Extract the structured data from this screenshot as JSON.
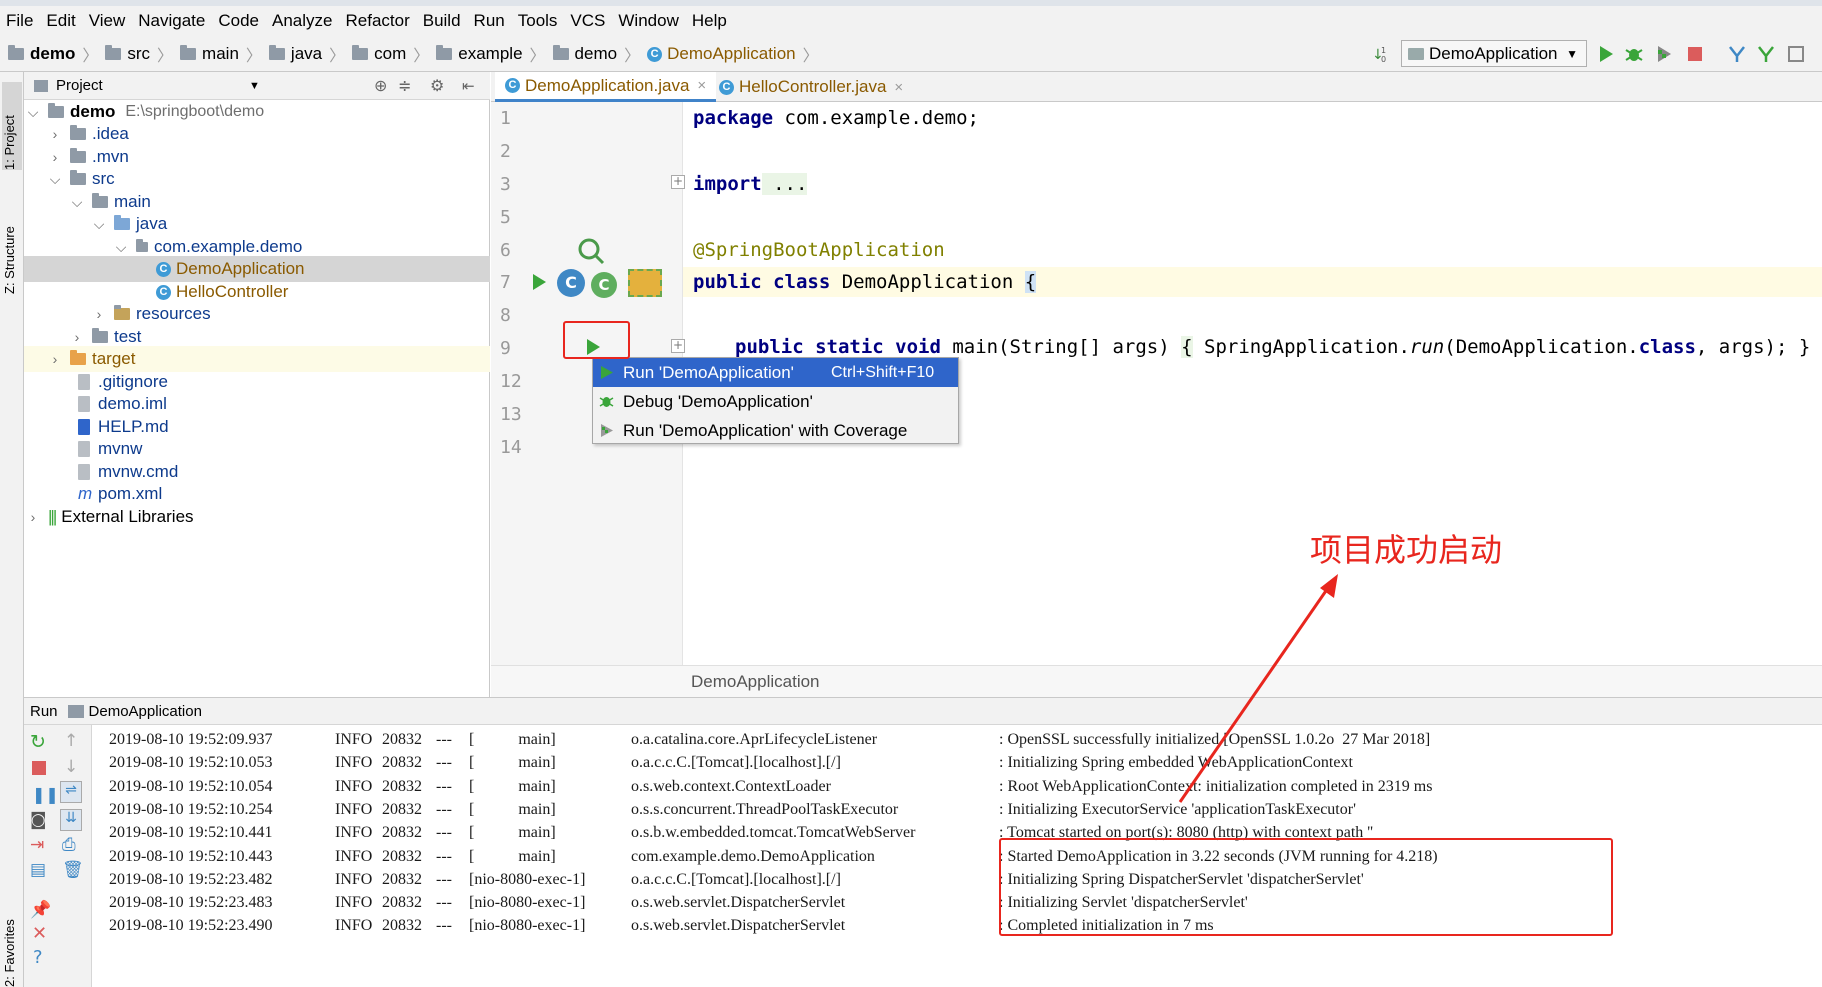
{
  "menu": [
    "File",
    "Edit",
    "View",
    "Navigate",
    "Code",
    "Analyze",
    "Refactor",
    "Build",
    "Run",
    "Tools",
    "VCS",
    "Window",
    "Help"
  ],
  "breadcrumbs": [
    "demo",
    "src",
    "main",
    "java",
    "com",
    "example",
    "demo",
    "DemoApplication"
  ],
  "run_config": "DemoApplication",
  "side_tabs": {
    "project": "1: Project",
    "structure": "Z: Structure",
    "favorites": "2: Favorites"
  },
  "project": {
    "header": "Project",
    "root": {
      "name": "demo",
      "path": "E:\\springboot\\demo"
    },
    "items": [
      ".idea",
      ".mvn",
      "src",
      "main",
      "java",
      "com.example.demo",
      "DemoApplication",
      "HelloController",
      "resources",
      "test",
      "target",
      ".gitignore",
      "demo.iml",
      "HELP.md",
      "mvnw",
      "mvnw.cmd",
      "pom.xml",
      "External Libraries"
    ]
  },
  "tabs": [
    "DemoApplication.java",
    "HelloController.java"
  ],
  "editor": {
    "line_numbers": [
      "1",
      "2",
      "3",
      "5",
      "6",
      "7",
      "8",
      "9",
      "12",
      "13",
      "14"
    ],
    "l1_kw": "package",
    "l1_rest": " com.example.demo;",
    "l3_kw": "import",
    "l3_rest": " ...",
    "annotation": "@SpringBootApplication",
    "l7_kw": "public class",
    "l7_rest": " DemoApplication ",
    "l7_brace": "{",
    "l9_kw": "public static void",
    "l9_rest1": " main(String[] args) ",
    "l9_brace": "{",
    "l9_rest2": " SpringApplication.",
    "l9_run": "run",
    "l9_rest3": "(DemoApplication.",
    "l9_class": "class",
    "l9_rest4": ", args); }",
    "footer": "DemoApplication"
  },
  "popup": {
    "run": "Run 'DemoApplication'",
    "run_shortcut": "Ctrl+Shift+F10",
    "debug": "Debug 'DemoApplication'",
    "coverage": "Run 'DemoApplication' with Coverage"
  },
  "run_panel": {
    "label": "Run",
    "config": "DemoApplication"
  },
  "log": [
    {
      "ts": "2019-08-10 19:52:09.937",
      "lvl": "INFO",
      "pid": "20832",
      "dash": "---",
      "thread": "[           main]",
      "logger": "o.a.catalina.core.AprLifecycleListener",
      "msg": ": OpenSSL successfully initialized [OpenSSL 1.0.2o  27 Mar 2018]"
    },
    {
      "ts": "2019-08-10 19:52:10.053",
      "lvl": "INFO",
      "pid": "20832",
      "dash": "---",
      "thread": "[           main]",
      "logger": "o.a.c.c.C.[Tomcat].[localhost].[/]",
      "msg": ": Initializing Spring embedded WebApplicationContext"
    },
    {
      "ts": "2019-08-10 19:52:10.054",
      "lvl": "INFO",
      "pid": "20832",
      "dash": "---",
      "thread": "[           main]",
      "logger": "o.s.web.context.ContextLoader",
      "msg": ": Root WebApplicationContext: initialization completed in 2319 ms"
    },
    {
      "ts": "2019-08-10 19:52:10.254",
      "lvl": "INFO",
      "pid": "20832",
      "dash": "---",
      "thread": "[           main]",
      "logger": "o.s.s.concurrent.ThreadPoolTaskExecutor",
      "msg": ": Initializing ExecutorService 'applicationTaskExecutor'"
    },
    {
      "ts": "2019-08-10 19:52:10.441",
      "lvl": "INFO",
      "pid": "20832",
      "dash": "---",
      "thread": "[           main]",
      "logger": "o.s.b.w.embedded.tomcat.TomcatWebServer",
      "msg": ": Tomcat started on port(s): 8080 (http) with context path ''"
    },
    {
      "ts": "2019-08-10 19:52:10.443",
      "lvl": "INFO",
      "pid": "20832",
      "dash": "---",
      "thread": "[           main]",
      "logger": "com.example.demo.DemoApplication",
      "msg": ": Started DemoApplication in 3.22 seconds (JVM running for 4.218)"
    },
    {
      "ts": "2019-08-10 19:52:23.482",
      "lvl": "INFO",
      "pid": "20832",
      "dash": "---",
      "thread": "[nio-8080-exec-1]",
      "logger": "o.a.c.c.C.[Tomcat].[localhost].[/]",
      "msg": ": Initializing Spring DispatcherServlet 'dispatcherServlet'"
    },
    {
      "ts": "2019-08-10 19:52:23.483",
      "lvl": "INFO",
      "pid": "20832",
      "dash": "---",
      "thread": "[nio-8080-exec-1]",
      "logger": "o.s.web.servlet.DispatcherServlet",
      "msg": ": Initializing Servlet 'dispatcherServlet'"
    },
    {
      "ts": "2019-08-10 19:52:23.490",
      "lvl": "INFO",
      "pid": "20832",
      "dash": "---",
      "thread": "[nio-8080-exec-1]",
      "logger": "o.s.web.servlet.DispatcherServlet",
      "msg": ": Completed initialization in 7 ms"
    }
  ],
  "annotation_text": "项目成功启动",
  "colors": {
    "accent": "#2f65ca",
    "annotation": "#e8261e",
    "run_green": "#3aa53a"
  }
}
